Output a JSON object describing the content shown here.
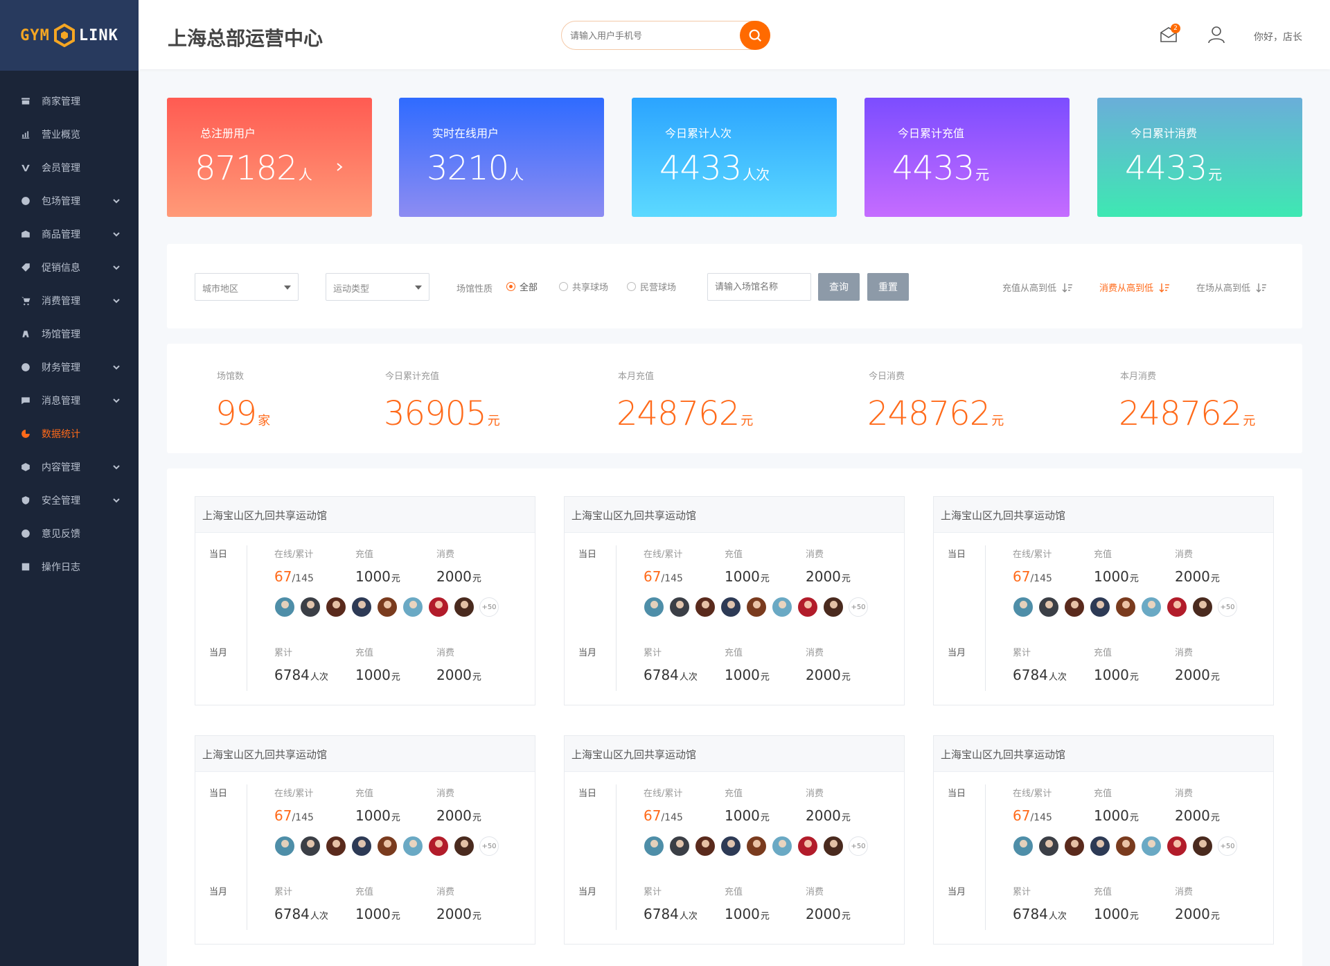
{
  "brand": {
    "left": "GYM",
    "right": "LINK"
  },
  "sidebar": {
    "items": [
      {
        "label": "商家管理",
        "icon": "store-icon",
        "expandable": false,
        "active": false
      },
      {
        "label": "营业概览",
        "icon": "bar-chart-icon",
        "expandable": false,
        "active": false
      },
      {
        "label": "会员管理",
        "icon": "vip-icon",
        "expandable": false,
        "active": false
      },
      {
        "label": "包场管理",
        "icon": "ball-icon",
        "expandable": true,
        "active": false
      },
      {
        "label": "商品管理",
        "icon": "goods-icon",
        "expandable": true,
        "active": false
      },
      {
        "label": "促销信息",
        "icon": "tag-icon",
        "expandable": true,
        "active": false
      },
      {
        "label": "消费管理",
        "icon": "cart-icon",
        "expandable": true,
        "active": false
      },
      {
        "label": "场馆管理",
        "icon": "venue-icon",
        "expandable": false,
        "active": false
      },
      {
        "label": "财务管理",
        "icon": "money-icon",
        "expandable": true,
        "active": false
      },
      {
        "label": "消息管理",
        "icon": "message-icon",
        "expandable": true,
        "active": false
      },
      {
        "label": "数据统计",
        "icon": "pie-chart-icon",
        "expandable": false,
        "active": true
      },
      {
        "label": "内容管理",
        "icon": "box-icon",
        "expandable": true,
        "active": false
      },
      {
        "label": "安全管理",
        "icon": "shield-icon",
        "expandable": true,
        "active": false
      },
      {
        "label": "意见反馈",
        "icon": "question-icon",
        "expandable": false,
        "active": false
      },
      {
        "label": "操作日志",
        "icon": "log-icon",
        "expandable": false,
        "active": false
      }
    ]
  },
  "header": {
    "title": "上海总部运营中心",
    "search_placeholder": "请输入用户手机号",
    "mail_badge": "2",
    "greeting": "你好，店长"
  },
  "kpis": [
    {
      "label": "总注册用户",
      "value": "87182",
      "unit": "人",
      "has_arrow": true
    },
    {
      "label": "实时在线用户",
      "value": "3210",
      "unit": "人",
      "has_arrow": false
    },
    {
      "label": "今日累计人次",
      "value": "4433",
      "unit": "人次",
      "has_arrow": false
    },
    {
      "label": "今日累计充值",
      "value": "4433",
      "unit": "元",
      "has_arrow": false
    },
    {
      "label": "今日累计消费",
      "value": "4433",
      "unit": "元",
      "has_arrow": false
    }
  ],
  "filter": {
    "city_select": "城市地区",
    "sport_select": "运动类型",
    "nature_label": "场馆性质",
    "radios": [
      {
        "label": "全部",
        "checked": true
      },
      {
        "label": "共享球场",
        "checked": false
      },
      {
        "label": "民营球场",
        "checked": false
      }
    ],
    "venue_placeholder": "请输入场馆名称",
    "query_btn": "查询",
    "reset_btn": "重置",
    "sorts": [
      {
        "label": "充值从高到低",
        "active": false
      },
      {
        "label": "消费从高到低",
        "active": true
      },
      {
        "label": "在场从高到低",
        "active": false
      }
    ]
  },
  "summary": [
    {
      "label": "场馆数",
      "value": "99",
      "unit": "家"
    },
    {
      "label": "今日累计充值",
      "value": "36905",
      "unit": "元"
    },
    {
      "label": "本月充值",
      "value": "248762",
      "unit": "元"
    },
    {
      "label": "今日消费",
      "value": "248762",
      "unit": "元"
    },
    {
      "label": "本月消费",
      "value": "248762",
      "unit": "元"
    }
  ],
  "venue_card": {
    "name": "上海宝山区九回共享运动馆",
    "today_label": "当日",
    "month_label": "当月",
    "today": {
      "online_label": "在线/累计",
      "online": "67",
      "total": "/145",
      "recharge_label": "充值",
      "recharge": "1000",
      "spend_label": "消费",
      "spend": "2000",
      "unit_yuan": "元"
    },
    "more_avatars": "+50",
    "avatar_colors": [
      "#4e8ea8",
      "#3b3f46",
      "#5a2a1c",
      "#2d3a55",
      "#7a3b1e",
      "#6aa9c4",
      "#b21c2a",
      "#4a2a1e"
    ],
    "month": {
      "total_label": "累计",
      "total": "6784",
      "total_unit": "人次",
      "recharge_label": "充值",
      "recharge": "1000",
      "spend_label": "消费",
      "spend": "2000",
      "unit_yuan": "元"
    }
  }
}
